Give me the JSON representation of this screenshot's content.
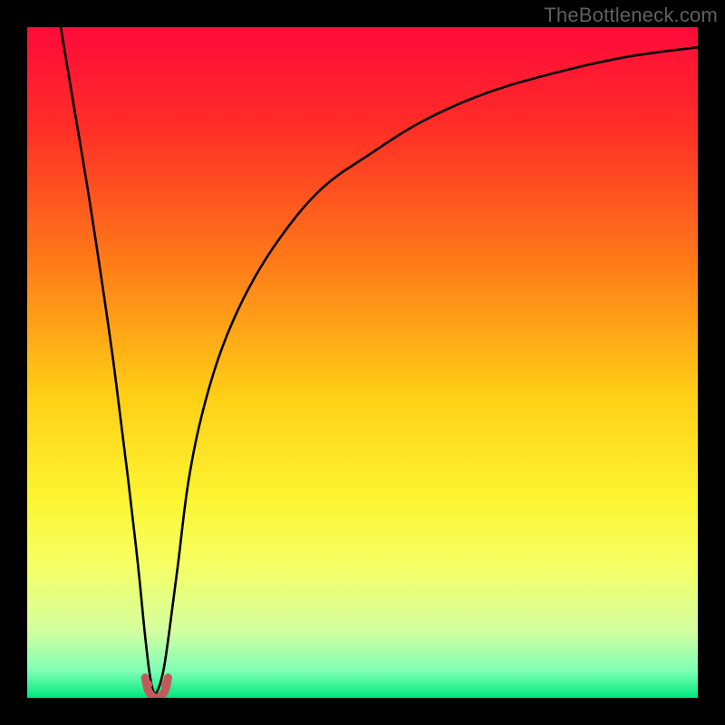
{
  "watermark": "TheBottleneck.com",
  "chart_data": {
    "type": "line",
    "title": "",
    "xlabel": "",
    "ylabel": "",
    "xlim": [
      0,
      100
    ],
    "ylim": [
      0,
      100
    ],
    "grid": false,
    "background_gradient": {
      "stops": [
        {
          "offset": 0.0,
          "color": "#ff0a3a"
        },
        {
          "offset": 0.15,
          "color": "#ff2e27"
        },
        {
          "offset": 0.35,
          "color": "#ff7a18"
        },
        {
          "offset": 0.55,
          "color": "#ffcf16"
        },
        {
          "offset": 0.7,
          "color": "#fcf430"
        },
        {
          "offset": 0.8,
          "color": "#f6ff63"
        },
        {
          "offset": 0.9,
          "color": "#d4ffa0"
        },
        {
          "offset": 0.96,
          "color": "#7dffb4"
        },
        {
          "offset": 1.0,
          "color": "#00e87e"
        }
      ]
    },
    "series": [
      {
        "name": "bottleneck-curve",
        "x": [
          5,
          7,
          9,
          11,
          13,
          15,
          16.5,
          17.5,
          18.2,
          18.8,
          19.4,
          20.3,
          21.2,
          22.5,
          24,
          26,
          29,
          33,
          38,
          44,
          51,
          59,
          68,
          78,
          89,
          100
        ],
        "y": [
          100,
          88,
          76,
          63,
          49,
          33,
          20,
          10,
          4,
          1,
          1,
          4,
          10,
          20,
          32,
          42,
          52,
          61,
          69,
          76,
          81,
          86,
          90,
          93,
          95.5,
          97
        ]
      }
    ],
    "markers": [
      {
        "name": "valley-left",
        "x": 18.0,
        "y": 2.0,
        "color": "#c25a5a",
        "size": 10
      },
      {
        "name": "valley-right",
        "x": 20.6,
        "y": 2.0,
        "color": "#c25a5a",
        "size": 10
      }
    ],
    "valley_stroke": {
      "color": "#c25a5a",
      "width": 9,
      "x": [
        17.6,
        18.0,
        18.6,
        19.3,
        20.0,
        20.6,
        21.0
      ],
      "y": [
        3.0,
        1.2,
        0.3,
        0.0,
        0.3,
        1.2,
        3.0
      ]
    }
  }
}
